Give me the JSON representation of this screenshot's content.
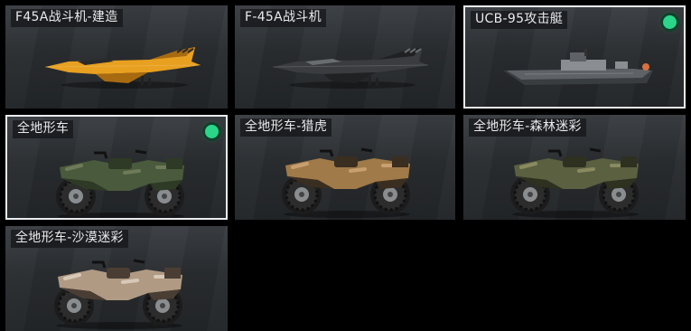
{
  "skins": [
    {
      "name": "F45A战斗机-建造",
      "kind": "jet",
      "colors": {
        "body": "#e8a020",
        "dark": "#a86a10",
        "accent": "#2a2a2a"
      },
      "equipped": false,
      "selected": false
    },
    {
      "name": "F-45A战斗机",
      "kind": "jet",
      "colors": {
        "body": "#3a3c3f",
        "dark": "#1f2123",
        "accent": "#6a6d70"
      },
      "equipped": false,
      "selected": false
    },
    {
      "name": "UCB-95攻击艇",
      "kind": "boat",
      "colors": {
        "body": "#5e6266",
        "dark": "#3a3d40",
        "accent": "#8a8e92"
      },
      "equipped": true,
      "selected": true
    },
    {
      "name": "全地形车",
      "kind": "atv",
      "colors": {
        "body": "#4a5a3c",
        "dark": "#2e3a26",
        "accent": "#6e7a58"
      },
      "equipped": true,
      "selected": true
    },
    {
      "name": "全地形车-猎虎",
      "kind": "atv",
      "colors": {
        "body": "#a07a48",
        "dark": "#3a2e20",
        "accent": "#c8a070"
      },
      "equipped": false,
      "selected": false
    },
    {
      "name": "全地形车-森林迷彩",
      "kind": "atv",
      "colors": {
        "body": "#5a6040",
        "dark": "#2e3020",
        "accent": "#8a8a60"
      },
      "equipped": false,
      "selected": false
    },
    {
      "name": "全地形车-沙漠迷彩",
      "kind": "atv",
      "colors": {
        "body": "#b09a84",
        "dark": "#4a3e34",
        "accent": "#d8c8b8"
      },
      "equipped": false,
      "selected": false
    }
  ],
  "colors": {
    "selected_border": "#e9ecef",
    "equipped_dot": "#2bd68a"
  }
}
